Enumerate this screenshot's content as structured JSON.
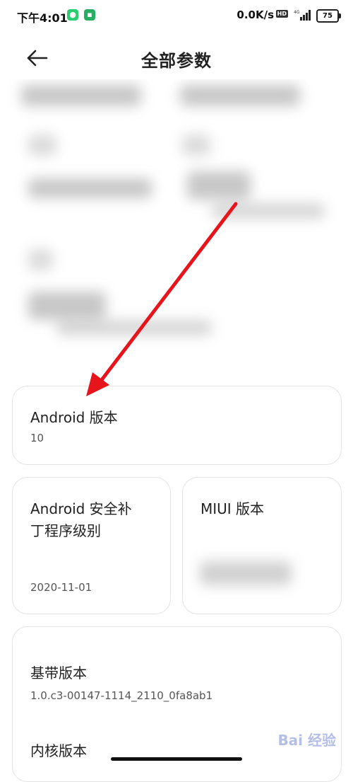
{
  "status_bar": {
    "time": "下午4:01",
    "network_speed": "0.0K/s",
    "hd_badge": "HD",
    "signal_label": "4G",
    "battery": "75"
  },
  "header": {
    "title": "全部参数",
    "back_icon": "arrow-left-icon"
  },
  "cards": {
    "android_version": {
      "label": "Android 版本",
      "value": "10"
    },
    "security_patch": {
      "label_line1": "Android 安全补",
      "label_line2": "丁程序级别",
      "value": "2020-11-01"
    },
    "miui_version": {
      "label": "MIUI 版本"
    },
    "baseband": {
      "label": "基带版本",
      "value": "1.0.c3-00147-1114_2110_0fa8ab1"
    },
    "kernel": {
      "label": "内核版本"
    }
  },
  "watermark": "Bai 经验",
  "colors": {
    "arrow": "#e8141b",
    "card_border": "#e3e3e3",
    "background": "#ffffff"
  }
}
